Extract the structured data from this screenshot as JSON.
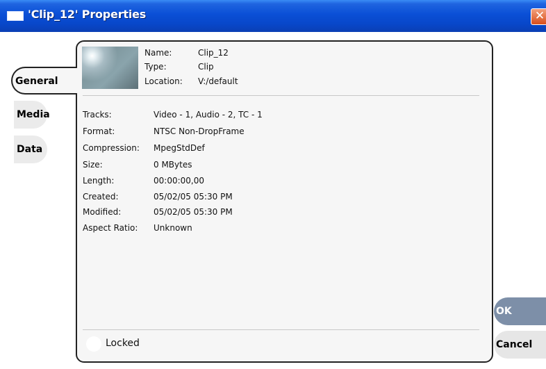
{
  "window": {
    "title": "'Clip_12' Properties",
    "close_symbol": "✕"
  },
  "tabs": [
    {
      "label": "General",
      "selected": true
    },
    {
      "label": "Media",
      "selected": false
    },
    {
      "label": "Data",
      "selected": false
    }
  ],
  "header": {
    "name_label": "Name:",
    "name_value": "Clip_12",
    "type_label": "Type:",
    "type_value": "Clip",
    "location_label": "Location:",
    "location_value": "V:/default"
  },
  "properties": [
    {
      "label": "Tracks:",
      "value": "Video - 1, Audio - 2, TC - 1"
    },
    {
      "label": "Format:",
      "value": "NTSC Non-DropFrame"
    },
    {
      "label": "Compression:",
      "value": "MpegStdDef"
    },
    {
      "label": "Size:",
      "value": "0 MBytes"
    },
    {
      "label": "Length:",
      "value": "00:00:00,00"
    },
    {
      "label": "Created:",
      "value": "05/02/05 05:30 PM"
    },
    {
      "label": "Modified:",
      "value": "05/02/05 05:30 PM"
    },
    {
      "label": "Aspect Ratio:",
      "value": "Unknown"
    }
  ],
  "locked": {
    "label": "Locked",
    "checked": false
  },
  "buttons": {
    "ok": "OK",
    "cancel": "Cancel"
  },
  "colors": {
    "titlebar": "#0a4fd6",
    "ok_button": "#7d8fa8",
    "panel": "#f6f6f6"
  }
}
